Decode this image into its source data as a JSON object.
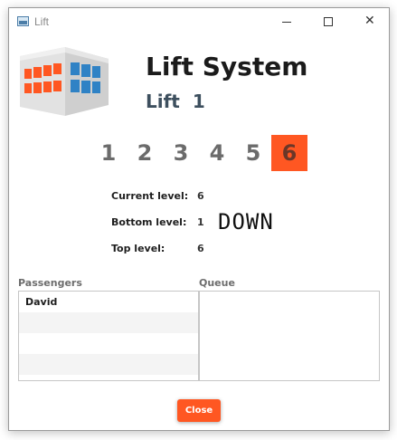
{
  "window": {
    "title": "Lift"
  },
  "header": {
    "app_title": "Lift System",
    "lift_word": "Lift",
    "lift_number": "1"
  },
  "floors": [
    "1",
    "2",
    "3",
    "4",
    "5",
    "6"
  ],
  "current_floor": "6",
  "info": {
    "current_level_label": "Current level:",
    "current_level": "6",
    "bottom_level_label": "Bottom level:",
    "bottom_level": "1",
    "top_level_label": "Top level:",
    "top_level": "6"
  },
  "direction": "DOWN",
  "passengers": {
    "header": "Passengers",
    "items": [
      "David"
    ]
  },
  "queue": {
    "header": "Queue",
    "items": []
  },
  "close_button": "Close",
  "colors": {
    "accent": "#ff5722",
    "building_blue": "#2f82c5",
    "building_orange": "#ff5722"
  },
  "icons": {
    "titlebar": "app-window-icon",
    "logo": "building-icon"
  }
}
